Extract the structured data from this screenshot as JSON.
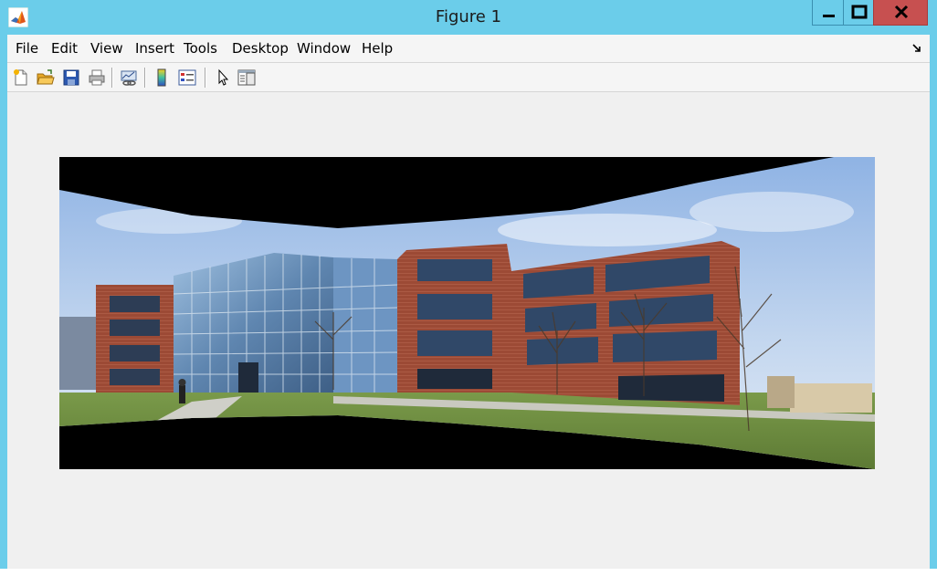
{
  "window": {
    "title": "Figure 1",
    "icon": "matlab-logo-icon",
    "controls": [
      "minimize-icon",
      "maximize-icon",
      "close-icon"
    ]
  },
  "menubar": {
    "items": [
      "File",
      "Edit",
      "View",
      "Insert",
      "Tools",
      "Desktop",
      "Window",
      "Help"
    ],
    "dock_icon": "dock-arrow-icon"
  },
  "toolbar": {
    "tools": [
      "new-figure-icon",
      "open-file-icon",
      "save-icon",
      "print-icon",
      "link-plot-icon",
      "insert-colorbar-icon",
      "insert-legend-icon",
      "edit-plot-pointer-icon",
      "property-inspector-icon"
    ]
  },
  "figure": {
    "content": "panorama-image"
  },
  "colors": {
    "titlebar": "#6bcdea",
    "close": "#c75050",
    "client_bg": "#f0f0f0",
    "image_bg": "#000000"
  }
}
